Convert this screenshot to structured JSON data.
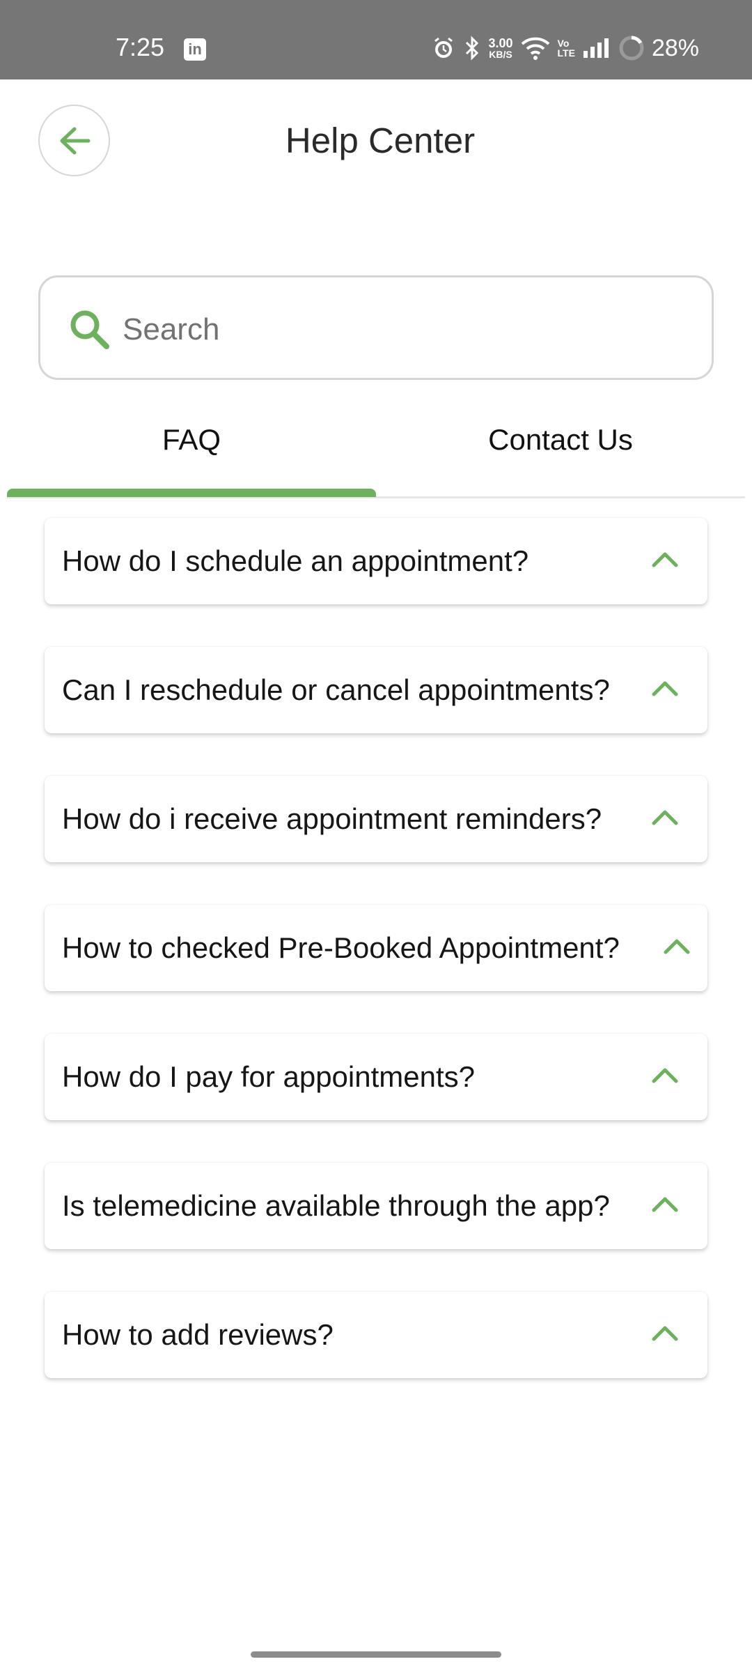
{
  "status_bar": {
    "time": "7:25",
    "linkedin_icon": "linkedin-icon",
    "net_speed_value": "3.00",
    "net_speed_unit": "KB/S",
    "volte_top": "Vo",
    "volte_bottom": "LTE",
    "battery": "28%",
    "icons": [
      "alarm-icon",
      "bluetooth-icon",
      "wifi-icon",
      "signal-icon",
      "battery-ring-icon"
    ]
  },
  "header": {
    "title": "Help Center",
    "back_icon": "arrow-left-icon"
  },
  "search": {
    "placeholder": "Search",
    "icon": "search-icon"
  },
  "tabs": [
    {
      "label": "FAQ",
      "active": true
    },
    {
      "label": "Contact Us",
      "active": false
    }
  ],
  "faq": [
    {
      "question": "How do I schedule an appointment?"
    },
    {
      "question": "Can I reschedule or cancel appointments?"
    },
    {
      "question": "How do i receive appointment reminders?"
    },
    {
      "question": "How to checked Pre-Booked Appointment?"
    },
    {
      "question": "How do I pay for appointments?"
    },
    {
      "question": "Is telemedicine available through the app?"
    },
    {
      "question": "How to add reviews?"
    }
  ],
  "colors": {
    "accent": "#6db05e",
    "status_bar": "#767676",
    "text": "#161616"
  }
}
